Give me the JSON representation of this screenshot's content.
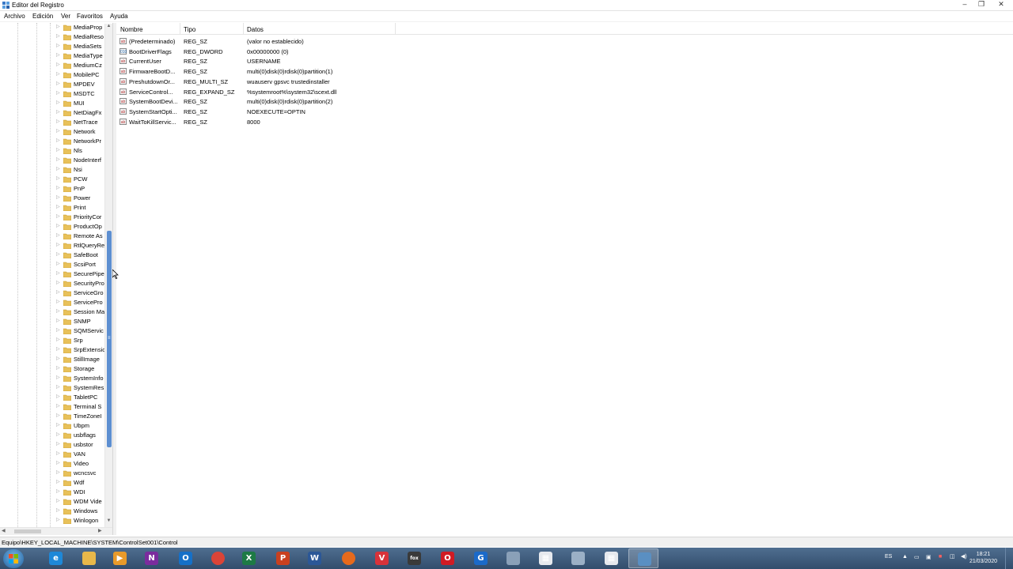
{
  "window": {
    "title": "Editor del Registro",
    "controls": [
      "–",
      "❐",
      "✕"
    ]
  },
  "menu": [
    "Archivo",
    "Edición",
    "Ver",
    "Favoritos",
    "Ayuda"
  ],
  "tree": {
    "items": [
      "MediaProp",
      "MediaReso",
      "MediaSets",
      "MediaType",
      "MediumCz",
      "MobilePC",
      "MPDEV",
      "MSDTC",
      "MUI",
      "NetDiagFx",
      "NetTrace",
      "Network",
      "NetworkPr",
      "Nls",
      "NodeInterf",
      "Nsi",
      "PCW",
      "PnP",
      "Power",
      "Print",
      "PriorityCor",
      "ProductOp",
      "Remote As",
      "RtlQueryRe",
      "SafeBoot",
      "ScsiPort",
      "SecurePipe",
      "SecurityPro",
      "ServiceGro",
      "ServicePro",
      "Session Ma",
      "SNMP",
      "SQMServic",
      "Srp",
      "SrpExtensio",
      "StillImage",
      "Storage",
      "SystemInfo",
      "SystemRes",
      "TabletPC",
      "Terminal S",
      "TimeZoneI",
      "Ubpm",
      "usbflags",
      "usbstor",
      "VAN",
      "Video",
      "wcncsvc",
      "Wdf",
      "WDI",
      "WDM Vide",
      "Windows",
      "Winlogon"
    ]
  },
  "values": {
    "headers": {
      "name": "Nombre",
      "type": "Tipo",
      "data": "Datos"
    },
    "rows": [
      {
        "name": "(Predeterminado)",
        "type": "REG_SZ",
        "data": "(valor no establecido)",
        "icon": "string"
      },
      {
        "name": "BootDriverFlags",
        "type": "REG_DWORD",
        "data": "0x00000000 (0)",
        "icon": "binary"
      },
      {
        "name": "CurrentUser",
        "type": "REG_SZ",
        "data": "USERNAME",
        "icon": "string"
      },
      {
        "name": "FirmwareBootD...",
        "type": "REG_SZ",
        "data": "multi(0)disk(0)rdisk(0)partition(1)",
        "icon": "string"
      },
      {
        "name": "PreshutdownOr...",
        "type": "REG_MULTI_SZ",
        "data": "wuauserv gpsvc trustedinstaller",
        "icon": "string"
      },
      {
        "name": "ServiceControl...",
        "type": "REG_EXPAND_SZ",
        "data": "%systemroot%\\system32\\scext.dll",
        "icon": "string"
      },
      {
        "name": "SystemBootDevi...",
        "type": "REG_SZ",
        "data": "multi(0)disk(0)rdisk(0)partition(2)",
        "icon": "string"
      },
      {
        "name": "SystemStartOpti...",
        "type": "REG_SZ",
        "data": " NOEXECUTE=OPTIN",
        "icon": "string"
      },
      {
        "name": "WaitToKillServic...",
        "type": "REG_SZ",
        "data": "8000",
        "icon": "string"
      }
    ]
  },
  "status": {
    "path": "Equipo\\HKEY_LOCAL_MACHINE\\SYSTEM\\ControlSet001\\Control"
  },
  "taskbar": {
    "apps": [
      {
        "name": "internet-explorer",
        "glyph": "e",
        "color": "#1e88d8"
      },
      {
        "name": "file-explorer",
        "glyph": "",
        "color": "#e8b84a"
      },
      {
        "name": "media-player",
        "glyph": "▶",
        "color": "#e89a2a"
      },
      {
        "name": "onenote",
        "glyph": "N",
        "color": "#7b2c9e"
      },
      {
        "name": "outlook",
        "glyph": "O",
        "color": "#1570c8"
      },
      {
        "name": "chrome",
        "glyph": "",
        "color": "#db4437"
      },
      {
        "name": "excel",
        "glyph": "X",
        "color": "#1d7a45"
      },
      {
        "name": "powerpoint",
        "glyph": "P",
        "color": "#c9401f"
      },
      {
        "name": "word",
        "glyph": "W",
        "color": "#2b5797"
      },
      {
        "name": "firefox",
        "glyph": "",
        "color": "#e66a1c"
      },
      {
        "name": "vivaldi",
        "glyph": "V",
        "color": "#d8323a"
      },
      {
        "name": "app-fox",
        "glyph": "fox",
        "color": "#3a3a3a"
      },
      {
        "name": "opera",
        "glyph": "O",
        "color": "#d01b24"
      },
      {
        "name": "app-g",
        "glyph": "G",
        "color": "#1b6ac9"
      },
      {
        "name": "app-cloud",
        "glyph": "",
        "color": "#8aa0b8"
      },
      {
        "name": "app-calendar",
        "glyph": "▦",
        "color": "#e6e9ee"
      },
      {
        "name": "app-network",
        "glyph": "",
        "color": "#9bb0c6"
      },
      {
        "name": "app-calc",
        "glyph": "▦",
        "color": "#e6e9ee"
      },
      {
        "name": "regedit",
        "glyph": "",
        "color": "#5a8fc2"
      }
    ],
    "tray": {
      "lang": "ES",
      "time": "18:21",
      "date": "21/03/2020"
    }
  }
}
